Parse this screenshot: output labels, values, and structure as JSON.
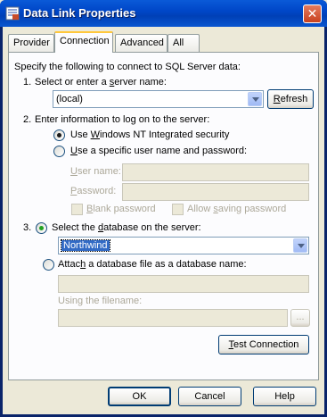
{
  "window": {
    "title": "Data Link Properties",
    "close_glyph": "✕"
  },
  "tabs": [
    {
      "label": "Provider"
    },
    {
      "label": "Connection"
    },
    {
      "label": "Advanced"
    },
    {
      "label": "All"
    }
  ],
  "connection": {
    "intro": "Specify the following to connect to SQL Server data:",
    "step1": {
      "number": "1.",
      "label_pre": "Select or enter a ",
      "label_ul": "s",
      "label_post": "erver name:",
      "server_value": "(local)",
      "refresh_ul": "R",
      "refresh_rest": "efresh"
    },
    "step2": {
      "number": "2.",
      "label": "Enter information to log on to the server:",
      "nt_pre": "Use ",
      "nt_ul": "W",
      "nt_post": "indows NT Integrated security",
      "specific_ul": "U",
      "specific_post": "se a specific user name and password:",
      "user_ul": "U",
      "user_post": "ser name:",
      "pw_ul": "P",
      "pw_post": "assword:",
      "blank_ul": "B",
      "blank_post": "lank password",
      "allow_pre": "Allow ",
      "allow_ul": "s",
      "allow_post": "aving password"
    },
    "step3": {
      "number": "3.",
      "select_pre": "Select the ",
      "select_ul": "d",
      "select_post": "atabase on the server:",
      "database_value": "Northwind",
      "attach_pre": "Attac",
      "attach_ul": "h",
      "attach_post": " a database file as a database name:",
      "filename_label": "Using the filename:",
      "browse_label": "..."
    },
    "test_ul": "T",
    "test_rest": "est Connection"
  },
  "footer": {
    "ok": "OK",
    "cancel": "Cancel",
    "help": "Help"
  },
  "colors": {
    "title_bar": "#0047c8",
    "close": "#c8411f",
    "tab_highlight": "#ffc83c",
    "selection": "#316ac5"
  }
}
